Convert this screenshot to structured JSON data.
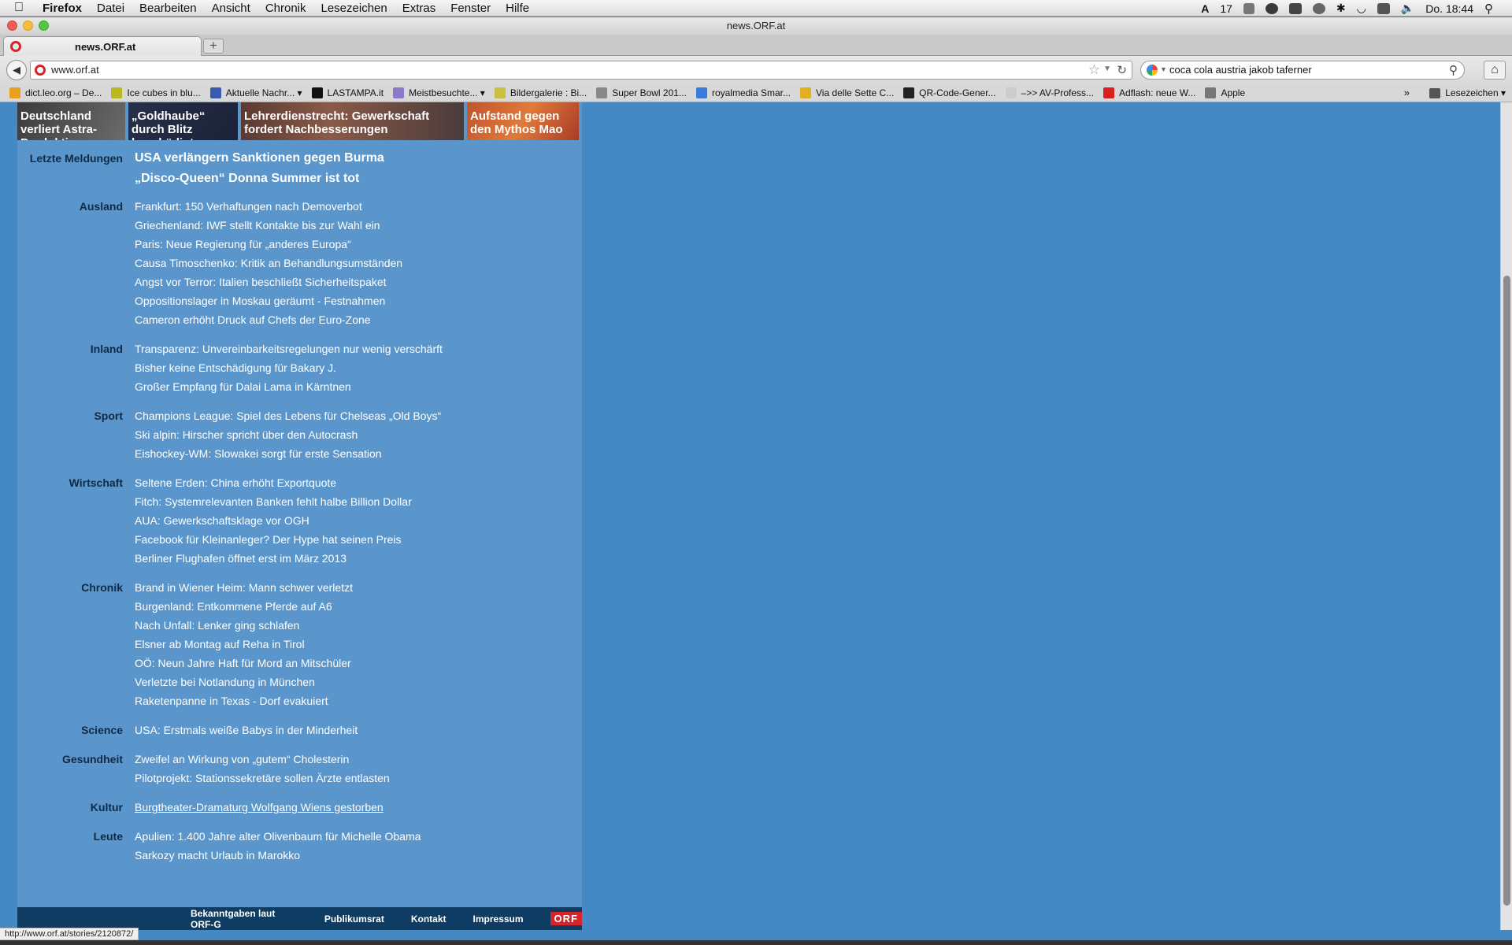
{
  "menubar": {
    "items": [
      "Firefox",
      "Datei",
      "Bearbeiten",
      "Ansicht",
      "Chronik",
      "Lesezeichen",
      "Extras",
      "Fenster",
      "Hilfe"
    ],
    "adobe_count": "17",
    "clock": "Do. 18:44"
  },
  "window": {
    "title": "news.ORF.at"
  },
  "tab": {
    "label": "news.ORF.at"
  },
  "nav": {
    "url": "www.orf.at",
    "search_query": "coca cola austria jakob taferner"
  },
  "bookmarks": [
    {
      "label": "dict.leo.org – De...",
      "color": "#e8a020"
    },
    {
      "label": "Ice cubes in blu...",
      "color": "#b8b820"
    },
    {
      "label": "Aktuelle Nachr... ▾",
      "color": "#3a5ab0"
    },
    {
      "label": "LASTAMPA.it",
      "color": "#111111"
    },
    {
      "label": "Meistbesuchte... ▾",
      "color": "#8b79c8"
    },
    {
      "label": "Bildergalerie : Bi...",
      "color": "#c8c040"
    },
    {
      "label": "Super Bowl 201...",
      "color": "#888888"
    },
    {
      "label": "royalmedia Smar...",
      "color": "#3a7ad8"
    },
    {
      "label": "Via delle Sette C...",
      "color": "#e0b020"
    },
    {
      "label": "QR-Code-Gener...",
      "color": "#222222"
    },
    {
      "label": "–>> AV-Profess...",
      "color": "#cccccc"
    },
    {
      "label": "Adflash: neue W...",
      "color": "#d82020"
    },
    {
      "label": "Apple",
      "color": "#777777"
    }
  ],
  "bookmarks_more": "»",
  "bookmarks_menu": "Lesezeichen ▾",
  "teasers": [
    "Deutschland verliert Astra-Produktion",
    "„Goldhaube“ durch Blitz beschädigt",
    "Lehrerdienstrecht: Gewerkschaft fordert Nachbesserungen",
    "Aufstand gegen den Mythos Mao"
  ],
  "sections": [
    {
      "label": "Letzte Meldungen",
      "big": true,
      "items": [
        "USA verlängern Sanktionen gegen Burma",
        "„Disco-Queen“ Donna Summer ist tot"
      ]
    },
    {
      "label": "Ausland",
      "items": [
        "Frankfurt: 150 Verhaftungen nach Demoverbot",
        "Griechenland: IWF stellt Kontakte bis zur Wahl ein",
        "Paris: Neue Regierung für „anderes Europa“",
        "Causa Timoschenko: Kritik an Behandlungsumständen",
        "Angst vor Terror: Italien beschließt Sicherheitspaket",
        "Oppositionslager in Moskau geräumt - Festnahmen",
        "Cameron erhöht Druck auf Chefs der Euro-Zone"
      ]
    },
    {
      "label": "Inland",
      "items": [
        "Transparenz: Unvereinbarkeitsregelungen nur wenig verschärft",
        "Bisher keine Entschädigung für Bakary J.",
        "Großer Empfang für Dalai Lama in Kärntnen"
      ]
    },
    {
      "label": "Sport",
      "items": [
        "Champions League: Spiel des Lebens für Chelseas „Old Boys“",
        "Ski alpin: Hirscher spricht über den Autocrash",
        "Eishockey-WM: Slowakei sorgt für erste Sensation"
      ]
    },
    {
      "label": "Wirtschaft",
      "items": [
        "Seltene Erden: China erhöht Exportquote",
        "Fitch: Systemrelevanten Banken fehlt halbe Billion Dollar",
        "AUA: Gewerkschaftsklage vor OGH",
        "Facebook für Kleinanleger? Der Hype hat seinen Preis",
        "Berliner Flughafen öffnet erst im März 2013"
      ]
    },
    {
      "label": "Chronik",
      "items": [
        "Brand in Wiener Heim: Mann schwer verletzt",
        "Burgenland: Entkommene Pferde auf A6",
        "Nach Unfall: Lenker ging schlafen",
        "Elsner ab Montag auf Reha in Tirol",
        "OÖ: Neun Jahre Haft für Mord an Mitschüler",
        "Verletzte bei Notlandung in München",
        "Raketenpanne in Texas - Dorf evakuiert"
      ]
    },
    {
      "label": "Science",
      "items": [
        "USA: Erstmals weiße Babys in der Minderheit"
      ]
    },
    {
      "label": "Gesundheit",
      "items": [
        "Zweifel an Wirkung von „gutem“ Cholesterin",
        "Pilotprojekt: Stationssekretäre sollen Ärzte entlasten"
      ]
    },
    {
      "label": "Kultur",
      "hover": true,
      "items": [
        "Burgtheater-Dramaturg Wolfgang Wiens gestorben"
      ]
    },
    {
      "label": "Leute",
      "items": [
        "Apulien: 1.400 Jahre alter Olivenbaum für Michelle Obama",
        "Sarkozy macht Urlaub in Marokko"
      ]
    }
  ],
  "footer": {
    "links": [
      "Bekanntgaben laut ORF-G",
      "Publikumsrat",
      "Kontakt",
      "Impressum"
    ],
    "logo": "ORF"
  },
  "status": {
    "url": "http://www.orf.at/stories/2120872/"
  }
}
